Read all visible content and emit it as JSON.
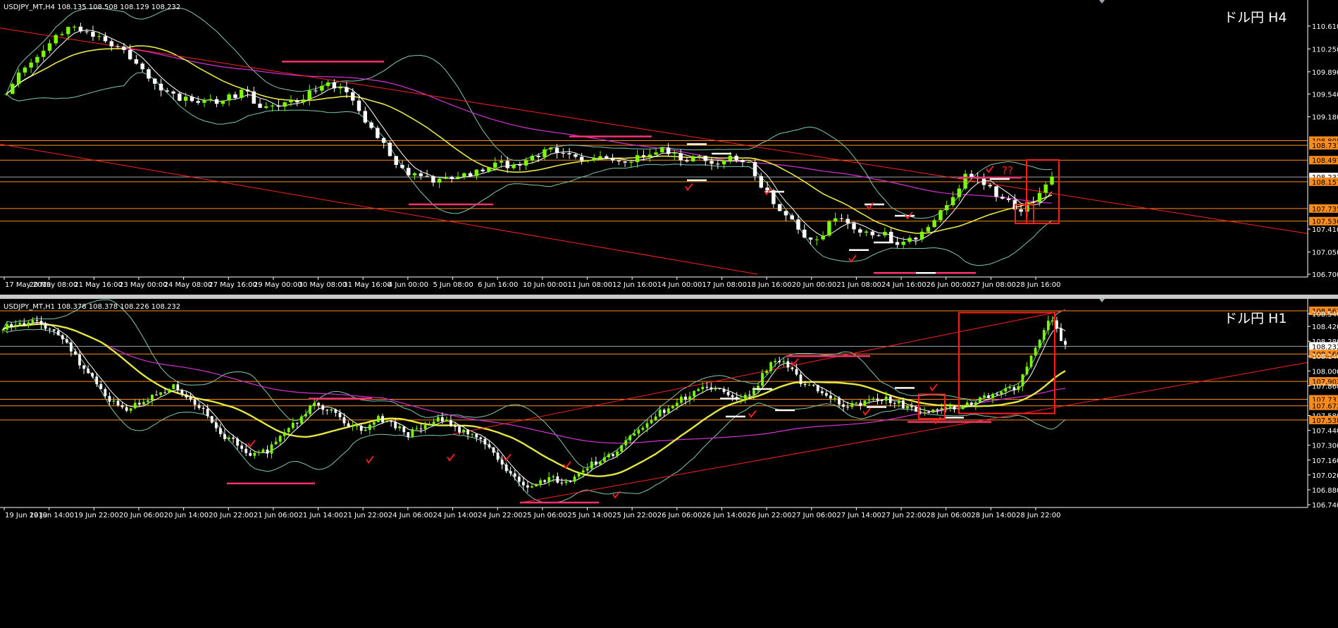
{
  "colors": {
    "background": "#000000",
    "bull": "#7CFC00",
    "bear": "#ffffff",
    "ma_fast": "#ffffff",
    "ma_mid": "#e6e640",
    "ma_slow": "#d433d4",
    "bands": "#7ec8b0",
    "level": "#ff8c1a",
    "trend": "#ff2020",
    "mark": "#ff3070",
    "bid": "#9aa4aa",
    "separator": "#c8c8c8"
  },
  "chart_data": [
    {
      "type": "candlestick",
      "symbol_header": "USDJPY_MT,H4  108.135 108.508 108.129 108.232",
      "title": "ドル円 H4",
      "ylim": [
        106.7,
        110.81
      ],
      "y_ticks": [
        "110.610",
        "110.250",
        "109.890",
        "109.540",
        "109.180",
        "108.805",
        "108.731",
        "108.497",
        "108.232",
        "108.157",
        "107.735",
        "107.536",
        "107.410",
        "107.050",
        "106.700"
      ],
      "level_labels": [
        "108.805",
        "108.731",
        "108.497",
        "108.157",
        "107.735",
        "107.536"
      ],
      "current_price": "108.232",
      "x_ticks": [
        "17 May 2019",
        "20 May 08:00",
        "21 May 16:00",
        "23 May 00:00",
        "24 May 08:00",
        "27 May 16:00",
        "29 May 00:00",
        "30 May 08:00",
        "31 May 16:00",
        "4 Jun 00:00",
        "5 Jun 08:00",
        "6 Jun 16:00",
        "10 Jun 00:00",
        "11 Jun 08:00",
        "12 Jun 16:00",
        "14 Jun 00:00",
        "17 Jun 08:00",
        "18 Jun 16:00",
        "20 Jun 00:00",
        "21 Jun 08:00",
        "24 Jun 16:00",
        "26 Jun 00:00",
        "27 Jun 08:00",
        "28 Jun 16:00"
      ],
      "close_path": [
        109.6,
        109.9,
        110.1,
        110.45,
        110.63,
        110.5,
        110.35,
        110.2,
        110.0,
        109.6,
        109.5,
        109.45,
        109.4,
        109.45,
        109.6,
        109.35,
        109.3,
        109.4,
        109.55,
        109.7,
        109.6,
        109.2,
        108.9,
        108.5,
        108.25,
        108.2,
        108.2,
        108.25,
        108.35,
        108.45,
        108.4,
        108.5,
        108.65,
        108.6,
        108.55,
        108.5,
        108.55,
        108.5,
        108.6,
        108.65,
        108.5,
        108.55,
        108.4,
        108.55,
        108.45,
        108.0,
        107.7,
        107.4,
        107.2,
        107.55,
        107.5,
        107.35,
        107.35,
        107.15,
        107.3,
        107.6,
        107.9,
        108.3,
        108.1,
        107.9,
        107.7,
        107.85,
        108.2
      ],
      "levels": [
        108.805,
        108.731,
        108.497,
        108.157,
        107.735,
        107.536
      ],
      "annotation": "??"
    },
    {
      "type": "candlestick",
      "symbol_header": "USDJPY_MT,H1  108.378 108.378 108.226 108.232",
      "title": "ドル円 H1",
      "ylim": [
        106.74,
        108.6
      ],
      "y_ticks": [
        "108.567",
        "108.540",
        "108.420",
        "108.280",
        "108.232",
        "108.160",
        "108.140",
        "108.000",
        "107.902",
        "107.860",
        "107.733",
        "107.672",
        "107.580",
        "107.538",
        "107.440",
        "107.300",
        "107.160",
        "107.020",
        "106.880",
        "106.740"
      ],
      "level_labels": [
        "108.567",
        "108.160",
        "107.902",
        "107.733",
        "107.672",
        "107.538"
      ],
      "current_price": "108.232",
      "x_ticks": [
        "19 Jun 2019",
        "19 Jun 14:00",
        "19 Jun 22:00",
        "20 Jun 06:00",
        "20 Jun 14:00",
        "20 Jun 22:00",
        "21 Jun 06:00",
        "21 Jun 14:00",
        "21 Jun 22:00",
        "24 Jun 06:00",
        "24 Jun 14:00",
        "24 Jun 22:00",
        "25 Jun 06:00",
        "25 Jun 14:00",
        "25 Jun 22:00",
        "26 Jun 06:00",
        "26 Jun 14:00",
        "26 Jun 22:00",
        "27 Jun 06:00",
        "27 Jun 14:00",
        "27 Jun 22:00",
        "28 Jun 06:00",
        "28 Jun 14:00",
        "28 Jun 22:00"
      ],
      "close_path": [
        108.42,
        108.44,
        108.46,
        108.4,
        108.3,
        108.05,
        107.9,
        107.7,
        107.65,
        107.7,
        107.8,
        107.85,
        107.75,
        107.6,
        107.4,
        107.32,
        107.2,
        107.25,
        107.4,
        107.55,
        107.7,
        107.62,
        107.5,
        107.45,
        107.55,
        107.5,
        107.4,
        107.5,
        107.55,
        107.45,
        107.4,
        107.3,
        107.1,
        106.95,
        106.9,
        107.0,
        106.95,
        107.05,
        107.15,
        107.2,
        107.35,
        107.5,
        107.6,
        107.7,
        107.78,
        107.85,
        107.8,
        107.7,
        107.8,
        108.05,
        108.1,
        107.9,
        107.85,
        107.75,
        107.65,
        107.7,
        107.75,
        107.72,
        107.65,
        107.6,
        107.62,
        107.65,
        107.7,
        107.75,
        107.8,
        107.85,
        108.2,
        108.5,
        108.23
      ],
      "levels": [
        108.567,
        108.16,
        107.902,
        107.733,
        107.672,
        107.538
      ]
    }
  ]
}
